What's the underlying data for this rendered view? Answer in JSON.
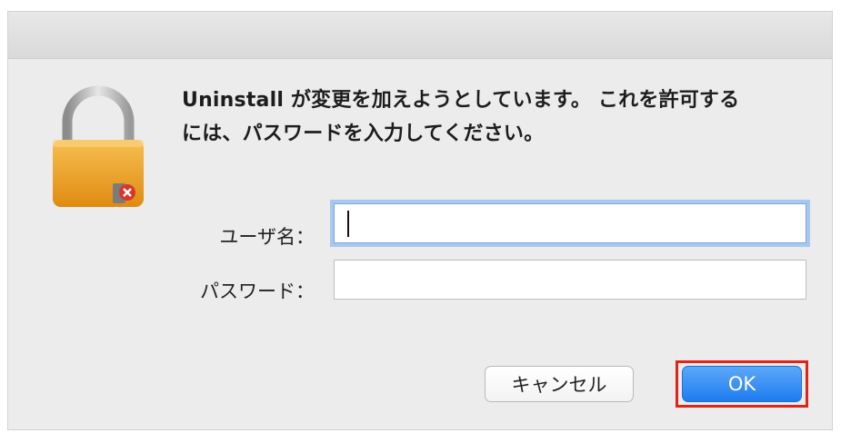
{
  "dialog": {
    "message_line1": "Uninstall が変更を加えようとしています。 これを許可する",
    "message_line2": "には、パスワードを入力してください。",
    "icon": "lock-icon",
    "fields": {
      "username_label": "ユーザ名：",
      "username_value": "",
      "password_label": "パスワード：",
      "password_value": ""
    },
    "buttons": {
      "cancel_label": "キャンセル",
      "ok_label": "OK"
    },
    "colors": {
      "ok_button": "#1f7cf0",
      "focus_ring": "#a8c8f0",
      "highlight_box": "#e2231a",
      "lock_body": "#f0a833"
    }
  }
}
